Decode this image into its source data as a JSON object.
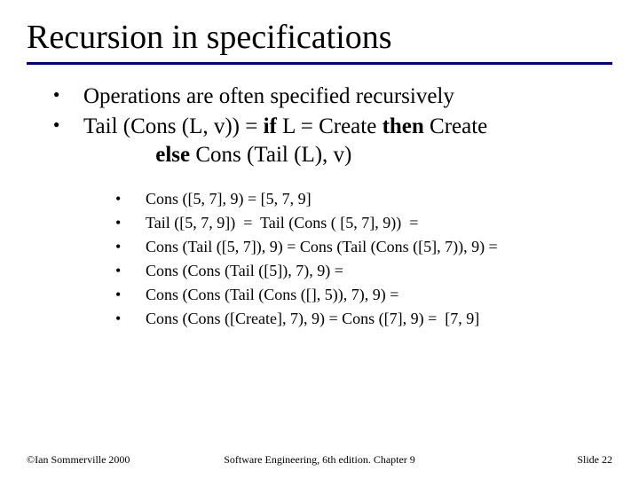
{
  "title": "Recursion in specifications",
  "bullets": {
    "b1": "Operations are often specified recursively",
    "b2_pre": "Tail (Cons (L, v)) = ",
    "b2_if": "if",
    "b2_mid": " L = Create ",
    "b2_then": "then",
    "b2_post1": " Create",
    "b2_line2_pad": "             ",
    "b2_else": "else",
    "b2_post2": " Cons (Tail (L), v)"
  },
  "sub": {
    "s1": "Cons ([5, 7], 9) = [5, 7, 9]",
    "s2": "Tail ([5, 7, 9])  =  Tail (Cons ( [5, 7], 9))  =",
    "s3": "Cons (Tail ([5, 7]), 9) = Cons (Tail (Cons ([5], 7)), 9) =",
    "s4": "Cons (Cons (Tail ([5]), 7), 9) =",
    "s5": "Cons (Cons (Tail (Cons ([], 5)), 7), 9) =",
    "s6": "Cons (Cons ([Create], 7), 9) = Cons ([7], 9) =  [7, 9]"
  },
  "footer": {
    "left": "©Ian Sommerville 2000",
    "center": "Software Engineering, 6th edition. Chapter 9",
    "right": "Slide 22"
  }
}
